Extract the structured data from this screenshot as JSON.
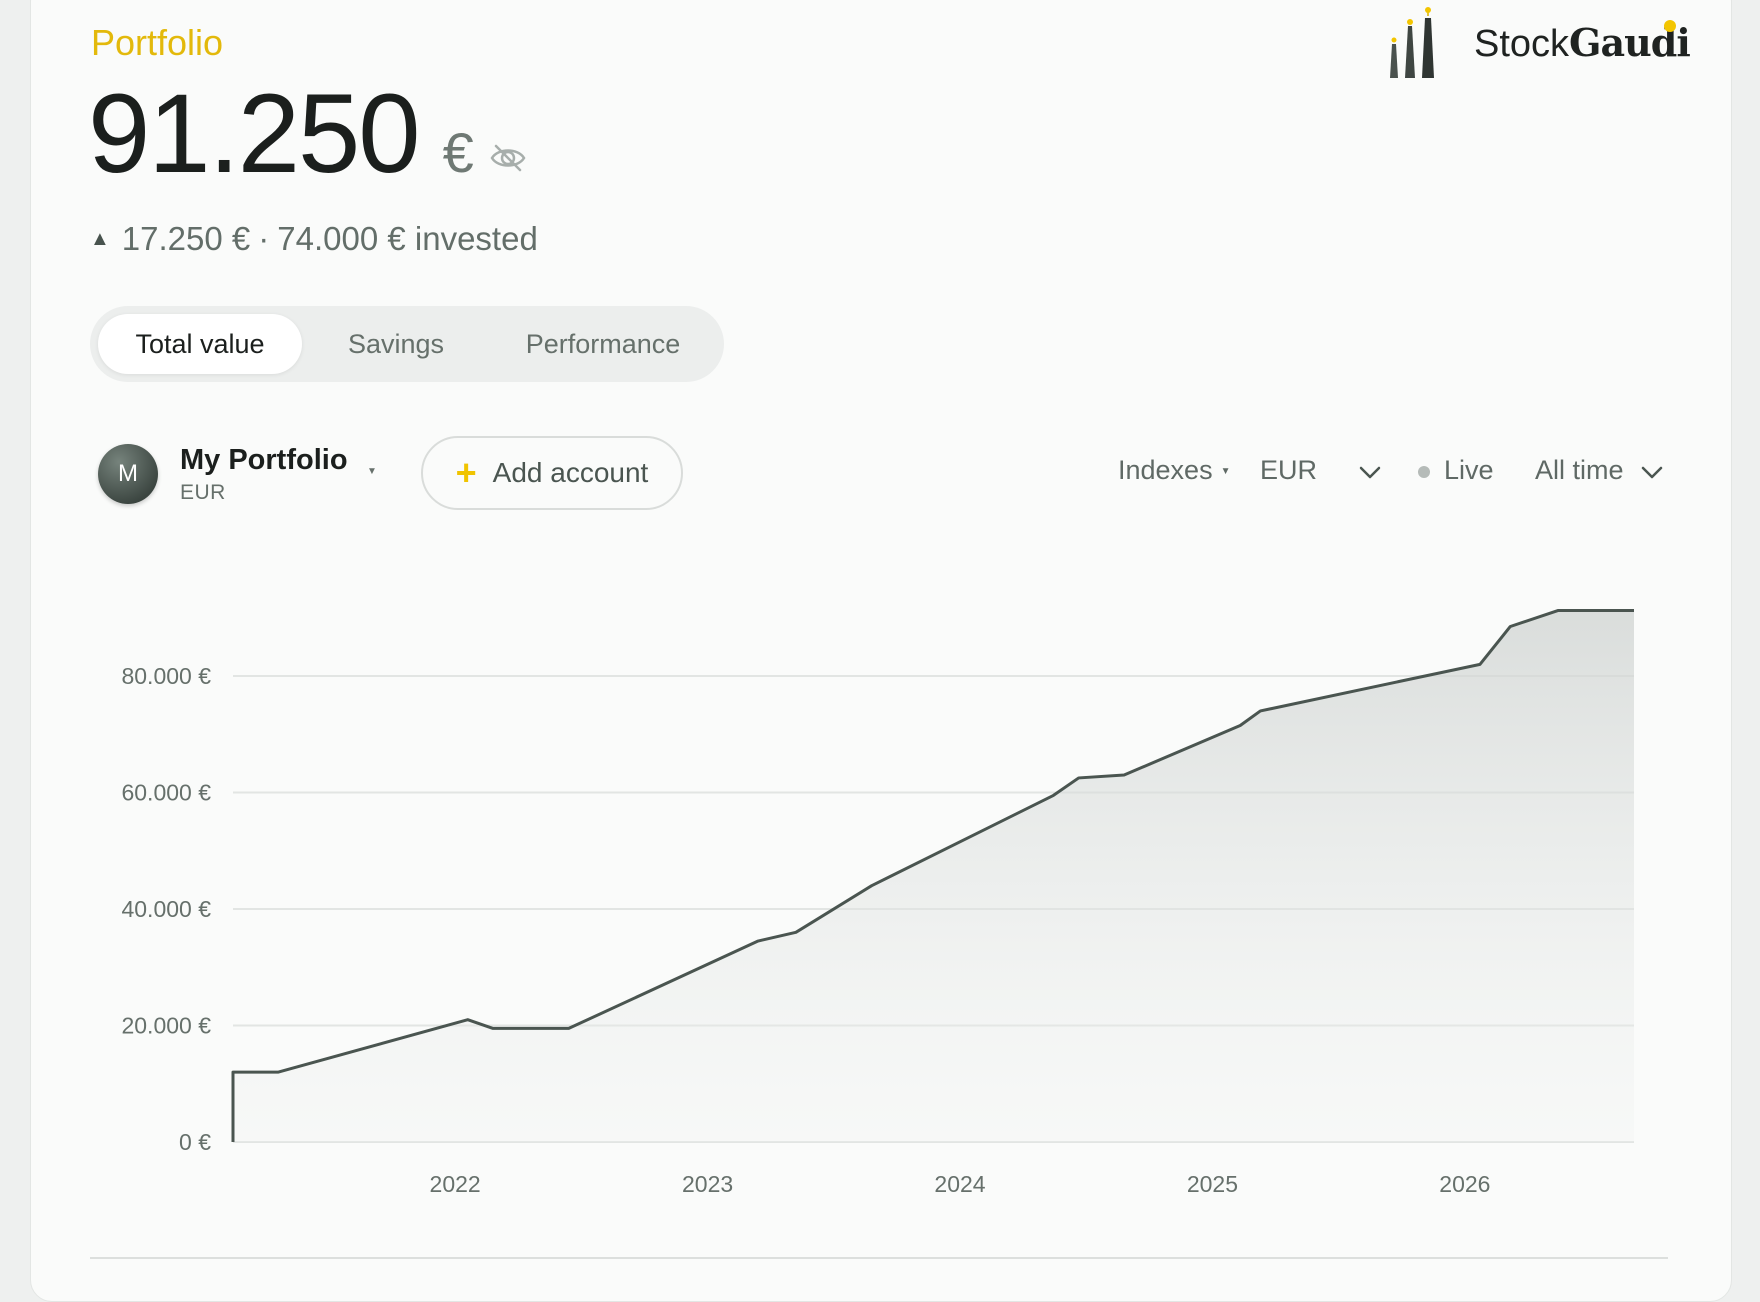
{
  "header": {
    "section_title": "Portfolio",
    "brand_stock": "Stock",
    "brand_gaudi": "Gaudi"
  },
  "summary": {
    "value": "91.250",
    "currency_symbol": "€",
    "gain": "17.250 €",
    "separator": "·",
    "invested": "74.000 € invested",
    "visibility_icon": "eye-off-icon"
  },
  "tabs": [
    {
      "label": "Total value",
      "active": true
    },
    {
      "label": "Savings",
      "active": false
    },
    {
      "label": "Performance",
      "active": false
    }
  ],
  "account": {
    "avatar_letter": "M",
    "name": "My Portfolio",
    "currency": "EUR",
    "add_label": "Add account"
  },
  "controls": {
    "indexes": "Indexes",
    "currency": "EUR",
    "live": "Live",
    "range": "All time"
  },
  "colors": {
    "accent": "#e3b90b",
    "line": "#4a5550",
    "grid": "#e2e5e3"
  },
  "chart_data": {
    "type": "area",
    "ylim": [
      0,
      80000
    ],
    "yticks": [
      0,
      20000,
      40000,
      60000,
      80000
    ],
    "ytick_labels": [
      "0 €",
      "20.000 €",
      "40.000 €",
      "60.000 €",
      "80.000 €"
    ],
    "xticks": [
      "2022",
      "2023",
      "2024",
      "2025",
      "2026"
    ],
    "x_tick_years": [
      2022.0,
      2023.0,
      2024.0,
      2025.0,
      2026.0
    ],
    "xlim": [
      2021.12,
      2026.67
    ],
    "series": [
      {
        "x": [
          2021.12,
          2021.12,
          2021.3,
          2022.05,
          2022.15,
          2022.45,
          2023.2,
          2023.35,
          2023.65,
          2024.37,
          2024.47,
          2024.65,
          2025.11,
          2025.19,
          2026.06,
          2026.18,
          2026.37,
          2026.67
        ],
        "y": [
          0,
          12000,
          12000,
          21000,
          19500,
          19500,
          34500,
          36000,
          44000,
          59500,
          62500,
          63000,
          71500,
          74000,
          82000,
          88500,
          91250,
          91250
        ]
      }
    ]
  }
}
